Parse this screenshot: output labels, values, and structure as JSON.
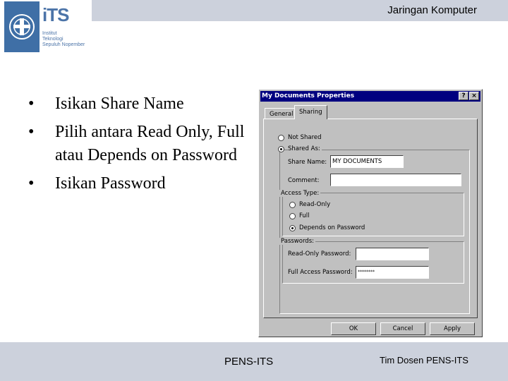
{
  "header": {
    "title": "Jaringan Komputer"
  },
  "logo": {
    "word": "iTS",
    "lines": [
      "Institut",
      "Teknologi",
      "Sepuluh Nopember"
    ]
  },
  "bullets": [
    "Isikan Share Name",
    "Pilih antara Read Only, Full atau Depends on Password",
    "Isikan Password"
  ],
  "dialog": {
    "title": "My Documents Properties",
    "help_label": "?",
    "close_label": "×",
    "tabs": [
      "General",
      "Sharing"
    ],
    "not_shared": "Not Shared",
    "shared_as": "Shared As:",
    "share_name_label": "Share Name:",
    "share_name_value": "MY DOCUMENTS",
    "comment_label": "Comment:",
    "comment_value": "",
    "access_type_label": "Access Type:",
    "access_read_only": "Read-Only",
    "access_full": "Full",
    "access_depends": "Depends on Password",
    "passwords_label": "Passwords:",
    "read_only_password_label": "Read-Only Password:",
    "read_only_password_value": "",
    "full_access_password_label": "Full Access Password:",
    "full_access_password_value": "********",
    "ok_label": "OK",
    "cancel_label": "Cancel",
    "apply_label": "Apply"
  },
  "footer": {
    "center": "PENS-ITS",
    "right": "Tim Dosen PENS-ITS"
  }
}
